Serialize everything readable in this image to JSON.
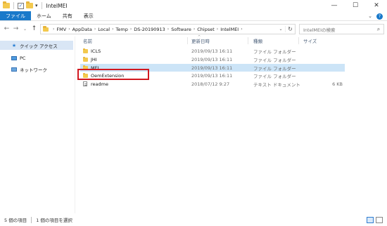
{
  "window": {
    "title": "IntelMEI",
    "min_glyph": "—",
    "max_glyph": "☐",
    "close_glyph": "✕"
  },
  "ribbon": {
    "tabs": [
      "ファイル",
      "ホーム",
      "共有",
      "表示"
    ]
  },
  "address": {
    "crumbs": [
      "FMV",
      "AppData",
      "Local",
      "Temp",
      "DS-20190913",
      "Software",
      "Chipset",
      "IntelMEI"
    ]
  },
  "search": {
    "placeholder": "IntelMEIの検索"
  },
  "sidebar": {
    "items": [
      {
        "label": "クイック アクセス",
        "icon": "star-icon"
      },
      {
        "label": "PC",
        "icon": "pc-icon"
      },
      {
        "label": "ネットワーク",
        "icon": "network-icon"
      }
    ]
  },
  "file_list": {
    "headers": {
      "name": "名前",
      "date": "更新日時",
      "type": "種類",
      "size": "サイズ"
    },
    "rows": [
      {
        "name": "ICLS",
        "date": "2019/09/13 16:11",
        "type": "ファイル フォルダー",
        "size": "",
        "icon": "folder-icon",
        "selected": false
      },
      {
        "name": "JHI",
        "date": "2019/09/13 16:11",
        "type": "ファイル フォルダー",
        "size": "",
        "icon": "folder-icon",
        "selected": false
      },
      {
        "name": "MEI",
        "date": "2019/09/13 16:11",
        "type": "ファイル フォルダー",
        "size": "",
        "icon": "folder-icon",
        "selected": true
      },
      {
        "name": "OemExtension",
        "date": "2019/09/13 16:11",
        "type": "ファイル フォルダー",
        "size": "",
        "icon": "folder-icon",
        "selected": false
      },
      {
        "name": "readme",
        "date": "2018/07/12 9:27",
        "type": "テキスト ドキュメント",
        "size": "6 KB",
        "icon": "text-file-icon",
        "selected": false
      }
    ]
  },
  "status": {
    "item_count": "5 個の項目",
    "selection": "1 個の項目を選択"
  },
  "colors": {
    "accent": "#1979ca",
    "selected_row": "#cce4f7",
    "highlight_box": "#d11820"
  }
}
